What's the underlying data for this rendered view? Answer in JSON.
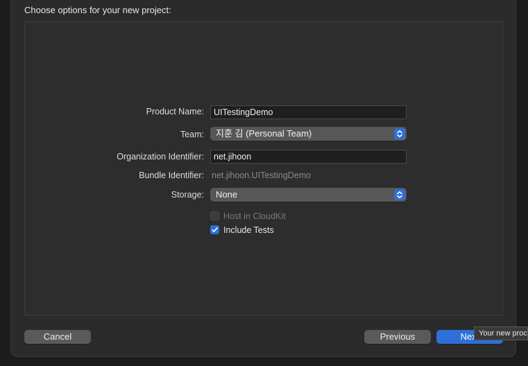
{
  "header": {
    "title": "Choose options for your new project:"
  },
  "form": {
    "product_name": {
      "label": "Product Name:",
      "value": "UITestingDemo"
    },
    "team": {
      "label": "Team:",
      "selected": "지훈 김 (Personal Team)"
    },
    "organization_identifier": {
      "label": "Organization Identifier:",
      "value": "net.jihoon"
    },
    "bundle_identifier": {
      "label": "Bundle Identifier:",
      "value": "net.jihoon.UITestingDemo"
    },
    "storage": {
      "label": "Storage:",
      "selected": "None"
    },
    "host_in_cloudkit": {
      "label": "Host in CloudKit",
      "checked": false,
      "enabled": false
    },
    "include_tests": {
      "label": "Include Tests",
      "checked": true,
      "enabled": true
    }
  },
  "footer": {
    "cancel_label": "Cancel",
    "previous_label": "Previous",
    "next_label": "Next"
  },
  "tooltip": {
    "text": "Your new proc"
  },
  "colors": {
    "accent": "#2f6fd8",
    "window_bg": "#2b2b2b",
    "panel_bg": "#2d2d2d"
  }
}
